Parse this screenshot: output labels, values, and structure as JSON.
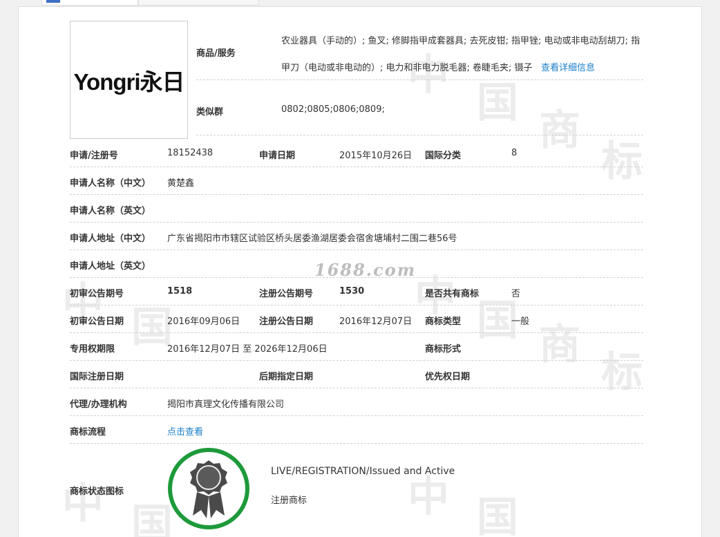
{
  "logo": {
    "text": "Yongri永日"
  },
  "goods": {
    "label": "商品/服务",
    "text": "农业器具（手动的）; 鱼叉; 修脚指甲成套器具; 去死皮钳; 指甲锉; 电动或非电动刮胡刀; 指甲刀（电动或非电动的）; 电力和非电力脱毛器; 卷睫毛夹; 镊子",
    "detail_link": "查看详细信息"
  },
  "similar_group": {
    "label": "类似群",
    "value": "0802;0805;0806;0809;"
  },
  "fields": {
    "reg_no_label": "申请/注册号",
    "reg_no": "18152438",
    "apply_date_label": "申请日期",
    "apply_date": "2015年10月26日",
    "intl_class_label": "国际分类",
    "intl_class": "8",
    "applicant_cn_label": "申请人名称（中文）",
    "applicant_cn": "黄楚鑫",
    "applicant_en_label": "申请人名称（英文）",
    "applicant_en": "",
    "address_cn_label": "申请人地址（中文）",
    "address_cn": "广东省揭阳市市辖区试验区桥头居委渔湖居委会宿舍塘埔村二围二巷56号",
    "address_en_label": "申请人地址（英文）",
    "address_en": "",
    "prelim_issue_label": "初审公告期号",
    "prelim_issue": "1518",
    "reg_issue_label": "注册公告期号",
    "reg_issue": "1530",
    "shared_label": "是否共有商标",
    "shared": "否",
    "prelim_date_label": "初审公告日期",
    "prelim_date": "2016年09月06日",
    "reg_date_label": "注册公告日期",
    "reg_date": "2016年12月07日",
    "mark_type_label": "商标类型",
    "mark_type": "一般",
    "exclusive_label": "专用权期限",
    "exclusive": "2016年12月07日 至 2026年12月06日",
    "mark_form_label": "商标形式",
    "mark_form": "",
    "intl_reg_date_label": "国际注册日期",
    "intl_reg_date": "",
    "later_date_label": "后期指定日期",
    "later_date": "",
    "priority_date_label": "优先权日期",
    "priority_date": "",
    "agent_label": "代理/办理机构",
    "agent": "揭阳市真理文化传播有限公司",
    "process_label": "商标流程",
    "process_link": "点击查看",
    "status_icon_label": "商标状态图标"
  },
  "status": {
    "english": "LIVE/REGISTRATION/Issued and Active",
    "chinese": "注册商标"
  },
  "watermark_site": "1688.com",
  "colors": {
    "link": "#1a7fc9",
    "badge_ring": "#1d9a3a",
    "badge_medal": "#4a4a4a"
  }
}
